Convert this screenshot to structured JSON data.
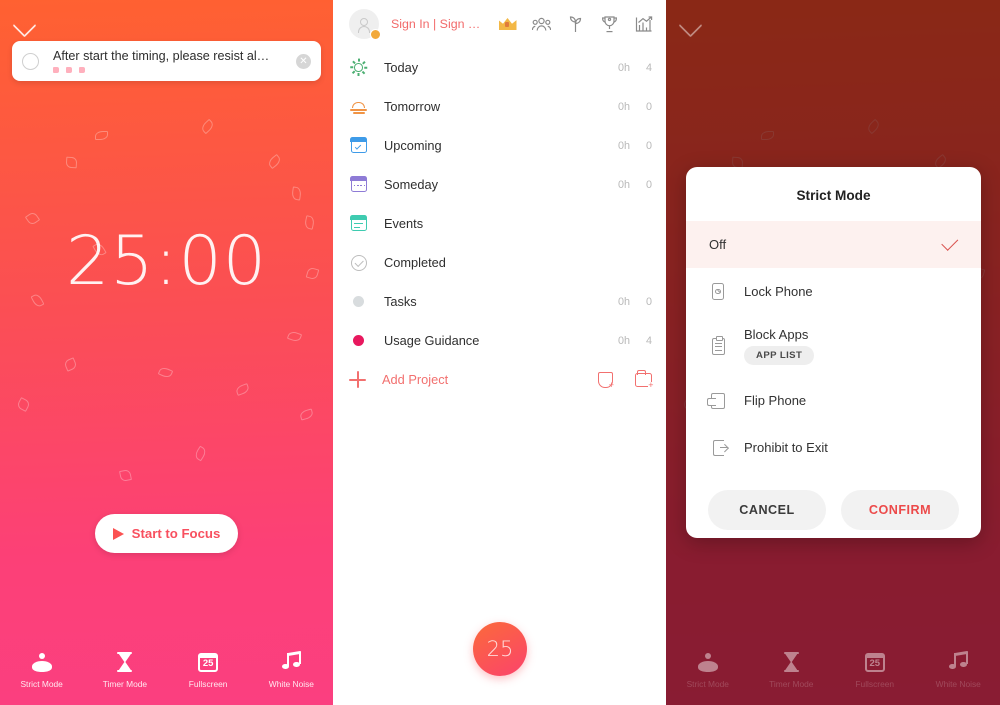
{
  "focus_panel": {
    "collapse_icon": "chevron-down-icon",
    "task": {
      "text": "After start the timing, please resist al…",
      "radio": "unchecked-radio",
      "close": "✕",
      "priority_flags": 3
    },
    "timer": "25:00",
    "start_button": {
      "label": "Start to Focus",
      "icon": "play-icon"
    },
    "nav": [
      {
        "label": "Strict Mode",
        "icon": "meditate-icon"
      },
      {
        "label": "Timer Mode",
        "icon": "hourglass-icon"
      },
      {
        "label": "Fullscreen",
        "icon": "pomodoro-25-icon"
      },
      {
        "label": "White Noise",
        "icon": "music-note-icon"
      }
    ],
    "colors": {
      "gradient_top": "#FF6131",
      "gradient_bottom": "#FB3F80",
      "accent": "#F8505F"
    }
  },
  "list_panel": {
    "header": {
      "avatar": "avatar-icon",
      "sign_in": "Sign In | Sign …",
      "icons": [
        {
          "name": "crown-icon"
        },
        {
          "name": "people-icon"
        },
        {
          "name": "sprout-icon"
        },
        {
          "name": "trophy-icon"
        },
        {
          "name": "statistics-icon"
        }
      ]
    },
    "rows": [
      {
        "label": "Today",
        "hours": "0h",
        "count": "4",
        "icon": "sun-icon",
        "color": "#4CAF72"
      },
      {
        "label": "Tomorrow",
        "hours": "0h",
        "count": "0",
        "icon": "sunrise-icon",
        "color": "#F09445"
      },
      {
        "label": "Upcoming",
        "hours": "0h",
        "count": "0",
        "icon": "calendar-check-icon",
        "color": "#3E9BE8"
      },
      {
        "label": "Someday",
        "hours": "0h",
        "count": "0",
        "icon": "calendar-dots-icon",
        "color": "#8E7BD6"
      },
      {
        "label": "Events",
        "hours": "",
        "count": "",
        "icon": "calendar-lines-icon",
        "color": "#3ECBB0"
      },
      {
        "label": "Completed",
        "hours": "",
        "count": "",
        "icon": "check-circle-icon",
        "color": "#BDBDBD"
      },
      {
        "label": "Tasks",
        "hours": "0h",
        "count": "0",
        "icon": "dot-icon",
        "color": "#D8DCDE"
      },
      {
        "label": "Usage Guidance",
        "hours": "0h",
        "count": "4",
        "icon": "dot-icon",
        "color": "#E8185E"
      }
    ],
    "add_project": {
      "label": "Add Project",
      "plus_icon": "plus-icon",
      "tag_icon": "add-tag-icon",
      "folder_icon": "add-folder-icon"
    },
    "fab": {
      "label": "25",
      "name": "pomodoro-fab"
    }
  },
  "dialog_panel": {
    "collapse_icon": "chevron-down-icon",
    "dialog": {
      "title": "Strict Mode",
      "options": [
        {
          "label": "Off",
          "icon": "",
          "selected": true
        },
        {
          "label": "Lock Phone",
          "icon": "phone-lock-icon",
          "selected": false
        },
        {
          "label": "Block Apps",
          "icon": "clipboard-icon",
          "selected": false,
          "chip": "APP LIST"
        },
        {
          "label": "Flip Phone",
          "icon": "flip-phone-icon",
          "selected": false
        },
        {
          "label": "Prohibit to Exit",
          "icon": "exit-door-icon",
          "selected": false
        }
      ],
      "cancel": "CANCEL",
      "confirm": "CONFIRM",
      "confirm_color": "#EC4A4A",
      "check_color": "#D9534F"
    },
    "nav": [
      {
        "label": "Strict Mode",
        "icon": "meditate-icon"
      },
      {
        "label": "Timer Mode",
        "icon": "hourglass-icon"
      },
      {
        "label": "Fullscreen",
        "icon": "pomodoro-25-icon"
      },
      {
        "label": "White Noise",
        "icon": "music-note-icon"
      }
    ]
  }
}
